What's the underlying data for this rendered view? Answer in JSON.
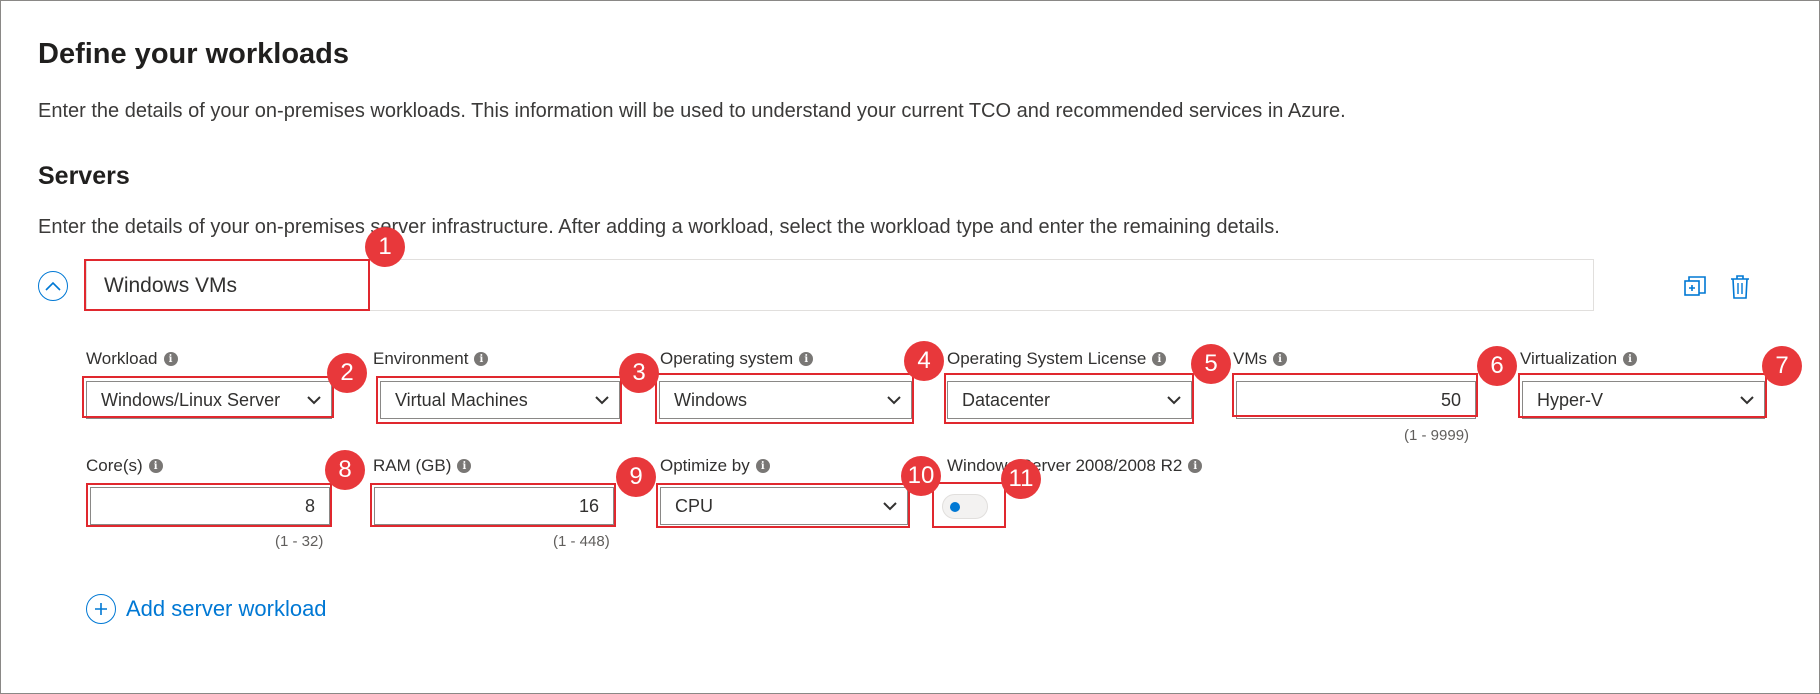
{
  "page": {
    "title": "Define your workloads",
    "description": "Enter the details of your on-premises workloads. This information will be used to understand your current TCO and recommended services in Azure."
  },
  "servers": {
    "heading": "Servers",
    "description": "Enter the details of your on-premises server infrastructure. After adding a workload, select the workload type and enter the remaining details.",
    "workload_name": "Windows VMs",
    "add_label": "Add server workload"
  },
  "fields": {
    "workload": {
      "label": "Workload",
      "value": "Windows/Linux Server"
    },
    "environment": {
      "label": "Environment",
      "value": "Virtual Machines"
    },
    "os": {
      "label": "Operating system",
      "value": "Windows"
    },
    "os_license": {
      "label": "Operating System License",
      "value": "Datacenter"
    },
    "vms": {
      "label": "VMs",
      "value": "50",
      "range": "(1 - 9999)"
    },
    "virtualization": {
      "label": "Virtualization",
      "value": "Hyper-V"
    },
    "cores": {
      "label": "Core(s)",
      "value": "8",
      "range": "(1 - 32)"
    },
    "ram": {
      "label": "RAM (GB)",
      "value": "16",
      "range": "(1 - 448)"
    },
    "optimize": {
      "label": "Optimize by",
      "value": "CPU"
    },
    "ws2008": {
      "label": "Windows Server 2008/2008 R2",
      "toggle_on": false
    }
  },
  "badges": [
    "1",
    "2",
    "3",
    "4",
    "5",
    "6",
    "7",
    "8",
    "9",
    "10",
    "11"
  ],
  "icons": {
    "collapse": "chevron-up-icon",
    "copy": "copy-icon",
    "delete": "trash-icon",
    "info": "info-icon",
    "dropdown": "chevron-down-icon",
    "add": "plus-icon"
  },
  "colors": {
    "accent": "#0078d4",
    "highlight": "#e0282e",
    "badge": "#e8383b"
  }
}
